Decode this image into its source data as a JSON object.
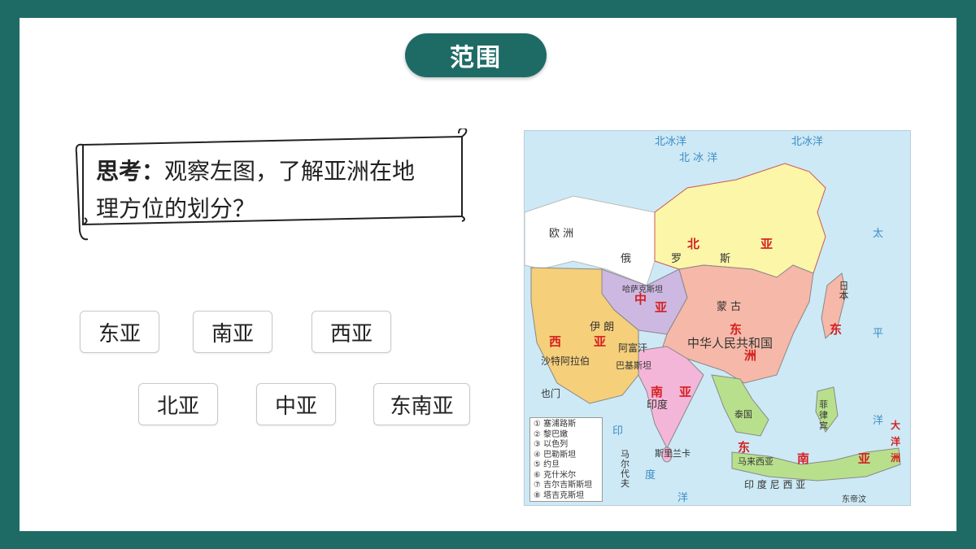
{
  "title": "范围",
  "question": {
    "prefix": "思考：",
    "line1": "观察左图，了解亚洲在地",
    "line2": "理方位的划分？"
  },
  "regions": [
    "东亚",
    "南亚",
    "西亚",
    "北亚",
    "中亚",
    "东南亚"
  ],
  "map": {
    "region_labels": [
      "北",
      "亚",
      "中",
      "亚",
      "东",
      "洲",
      "南",
      "亚",
      "西",
      "亚",
      "东",
      "亚",
      "南",
      "亚"
    ],
    "country_labels": {
      "russia1": "俄",
      "russia2": "罗",
      "russia3": "斯",
      "mongolia": "蒙  古",
      "china": "中华人民共和国",
      "india": "印度",
      "kazakh": "哈萨克斯坦",
      "iran": "伊  朗",
      "afghan": "阿富汗",
      "pakistan": "巴基斯坦",
      "saudi": "沙特阿拉伯",
      "yemen": "也门",
      "japan": "日本",
      "thailand": "泰国",
      "srilanka": "斯里兰卡",
      "maldives": "马尔代夫",
      "malaysia": "马来西亚",
      "philippines": "菲律宾",
      "indonesia": "印  度  尼  西  亚",
      "easttimor": "东帝汶"
    },
    "sea_labels": {
      "arctic1": "北  冰  洋",
      "arctic2": "北冰洋",
      "pacific1": "太",
      "pacific2": "平",
      "pacific3": "洋",
      "indian1": "印",
      "indian2": "度",
      "indian3": "洋",
      "europe": "欧      洲",
      "oceania": "大洋洲"
    },
    "legend": [
      "① 塞浦路斯",
      "② 黎巴嫩",
      "③ 以色列",
      "④ 巴勒斯坦",
      "⑤ 约旦",
      "⑥ 克什米尔",
      "⑦ 吉尔吉斯斯坦",
      "⑧ 塔吉克斯坦"
    ],
    "colors": {
      "sea": "#cde9f5",
      "north": "#fbf6a8",
      "east": "#f6b8a8",
      "central": "#cdb8e2",
      "south": "#f4b6d8",
      "west": "#f5cf7a",
      "southeast": "#b8e08c",
      "europe": "#ffffff"
    }
  }
}
